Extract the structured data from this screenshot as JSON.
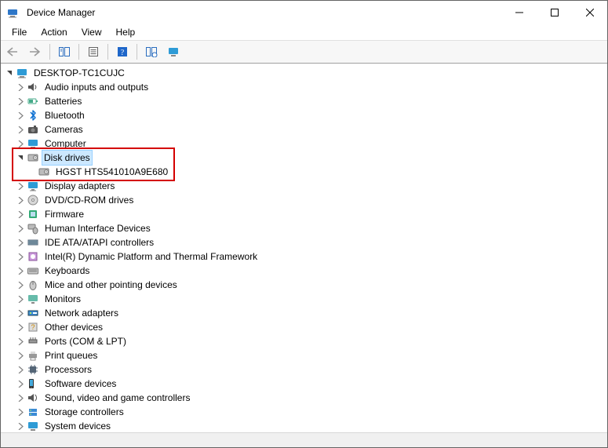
{
  "window": {
    "title": "Device Manager"
  },
  "menubar": {
    "file": "File",
    "action": "Action",
    "view": "View",
    "help": "Help"
  },
  "tree": {
    "root": {
      "label": "DESKTOP-TC1CUJC",
      "icon": "computer-icon",
      "expanded": true
    },
    "nodes": [
      {
        "label": "Audio inputs and outputs",
        "icon": "audio-icon",
        "expanded": false
      },
      {
        "label": "Batteries",
        "icon": "battery-icon",
        "expanded": false
      },
      {
        "label": "Bluetooth",
        "icon": "bluetooth-icon",
        "expanded": false
      },
      {
        "label": "Cameras",
        "icon": "camera-icon",
        "expanded": false
      },
      {
        "label": "Computer",
        "icon": "computer-icon",
        "expanded": false
      },
      {
        "label": "Disk drives",
        "icon": "disk-icon",
        "expanded": true,
        "selected": true,
        "children": [
          {
            "label": "HGST HTS541010A9E680",
            "icon": "disk-icon"
          }
        ]
      },
      {
        "label": "Display adapters",
        "icon": "display-icon",
        "expanded": false
      },
      {
        "label": "DVD/CD-ROM drives",
        "icon": "dvd-icon",
        "expanded": false
      },
      {
        "label": "Firmware",
        "icon": "firmware-icon",
        "expanded": false
      },
      {
        "label": "Human Interface Devices",
        "icon": "hid-icon",
        "expanded": false
      },
      {
        "label": "IDE ATA/ATAPI controllers",
        "icon": "ide-icon",
        "expanded": false
      },
      {
        "label": "Intel(R) Dynamic Platform and Thermal Framework",
        "icon": "intel-icon",
        "expanded": false
      },
      {
        "label": "Keyboards",
        "icon": "keyboard-icon",
        "expanded": false
      },
      {
        "label": "Mice and other pointing devices",
        "icon": "mouse-icon",
        "expanded": false
      },
      {
        "label": "Monitors",
        "icon": "monitor-icon",
        "expanded": false
      },
      {
        "label": "Network adapters",
        "icon": "network-icon",
        "expanded": false
      },
      {
        "label": "Other devices",
        "icon": "other-icon",
        "expanded": false
      },
      {
        "label": "Ports (COM & LPT)",
        "icon": "ports-icon",
        "expanded": false
      },
      {
        "label": "Print queues",
        "icon": "printer-icon",
        "expanded": false
      },
      {
        "label": "Processors",
        "icon": "processor-icon",
        "expanded": false
      },
      {
        "label": "Software devices",
        "icon": "software-icon",
        "expanded": false
      },
      {
        "label": "Sound, video and game controllers",
        "icon": "sound-icon",
        "expanded": false
      },
      {
        "label": "Storage controllers",
        "icon": "storage-icon",
        "expanded": false
      },
      {
        "label": "System devices",
        "icon": "system-icon",
        "expanded": false
      }
    ]
  }
}
